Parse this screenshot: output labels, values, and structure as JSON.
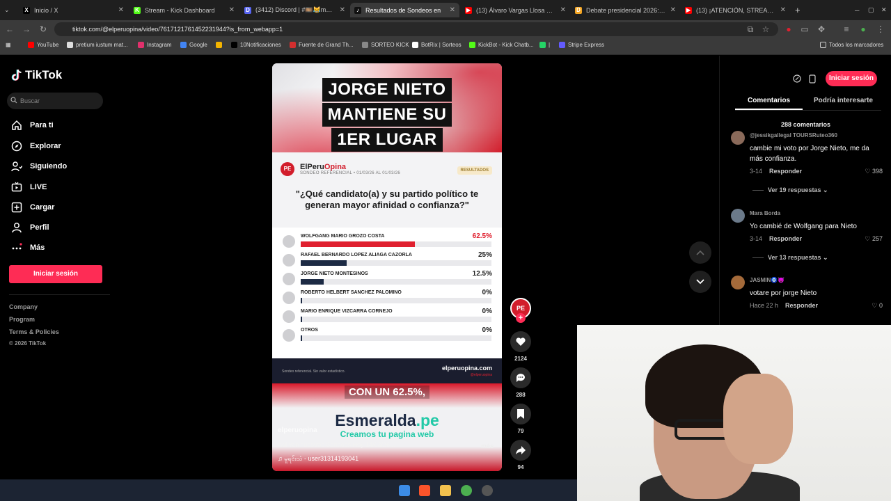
{
  "browser": {
    "tabs": [
      {
        "title": "Inicio / X",
        "color": "#000000",
        "glyph": "X"
      },
      {
        "title": "Stream - Kick Dashboard",
        "color": "#53fc18",
        "glyph": "K"
      },
      {
        "title": "(3412) Discord | #🎞️😹memes",
        "color": "#5865f2",
        "glyph": "D"
      },
      {
        "title": "Resultados de Sondeos en",
        "color": "#111111",
        "glyph": "♪"
      },
      {
        "title": "(13) Álvaro Vargas Llosa advierte",
        "color": "#ff0000",
        "glyph": "▶"
      },
      {
        "title": "Debate presidencial 2026: hoy",
        "color": "#f5a623",
        "glyph": "D"
      },
      {
        "title": "(13) ¡ATENCIÓN, STREAMERS!",
        "color": "#ff0000",
        "glyph": "▶"
      }
    ],
    "new_tab": "+",
    "url": "tiktok.com/@elperuopina/video/7617121761452231944?is_from_webapp=1",
    "bookmarks": [
      {
        "label": "YouTube",
        "color": "#ff0000"
      },
      {
        "label": "pretium iustum mat...",
        "color": "#dddddd"
      },
      {
        "label": "Instagram",
        "color": "#e1306c"
      },
      {
        "label": "Google",
        "color": "#4285f4"
      },
      {
        "label": "",
        "color": "#f4b400"
      },
      {
        "label": "10Notificaciones",
        "color": "#000000"
      },
      {
        "label": "Fuente de Grand Th...",
        "color": "#d32f2f"
      },
      {
        "label": "SORTEO KICK",
        "color": "#888888"
      },
      {
        "label": "BotRix | Sorteos",
        "color": "#ffffff"
      },
      {
        "label": "KickBot - Kick Chatb...",
        "color": "#53fc18"
      },
      {
        "label": "|",
        "color": "#25d366"
      },
      {
        "label": "Stripe Express",
        "color": "#635bff"
      }
    ],
    "all_bookmarks": "Todos los marcadores"
  },
  "sidebar": {
    "logo": "TikTok",
    "search_placeholder": "Buscar",
    "nav": [
      {
        "label": "Para ti",
        "icon": "home-icon"
      },
      {
        "label": "Explorar",
        "icon": "compass-icon"
      },
      {
        "label": "Siguiendo",
        "icon": "following-icon"
      },
      {
        "label": "LIVE",
        "icon": "live-icon"
      },
      {
        "label": "Cargar",
        "icon": "upload-icon"
      },
      {
        "label": "Perfil",
        "icon": "profile-icon"
      },
      {
        "label": "Más",
        "icon": "more-icon"
      }
    ],
    "login": "Iniciar sesión",
    "footer": [
      "Company",
      "Program",
      "Terms & Policies",
      "© 2026 TikTok"
    ]
  },
  "video": {
    "headline": [
      "JORGE NIETO",
      "MANTIENE SU",
      "1ER LUGAR"
    ],
    "brand_badge": "PE",
    "brand_name_a": "ElPeru",
    "brand_name_b": "Opina",
    "brand_sub": "SONDEO REFERENCIAL • 01/03/26 AL 01/03/26",
    "result_tag": "RESULTADOS",
    "question": "\"¿Qué candidato(a) y su partido político te generan mayor afinidad o confianza?\"",
    "results": [
      {
        "name": "WOLFGANG MARIO GROZO COSTA",
        "pct_label": "62.5%",
        "value": 62.5
      },
      {
        "name": "RAFAEL BERNARDO LOPEZ ALIAGA CAZORLA",
        "pct_label": "25%",
        "value": 25
      },
      {
        "name": "JORGE NIETO MONTESINOS",
        "pct_label": "12.5%",
        "value": 12.5
      },
      {
        "name": "ROBERTO HELBERT SANCHEZ PALOMINO",
        "pct_label": "0%",
        "value": 0
      },
      {
        "name": "MARIO ENRIQUE VIZCARRA CORNEJO",
        "pct_label": "0%",
        "value": 0
      },
      {
        "name": "OTROS",
        "pct_label": "0%",
        "value": 0
      }
    ],
    "footer_note": "Sondeo referencial. Sin valor estadístico.",
    "footer_site": "elperuopina.com",
    "footer_handle": "@elperuopina",
    "caption_overlay": "CON UN 62.5%,",
    "ad_a": "Esmeralda",
    "ad_b": ".pe",
    "ad_sub": "Creamos tu pagina web",
    "username": "elperuopina",
    "description": "Así van nuestros Sondeos Hoy 14/03/26...",
    "more": "más",
    "music": "♫  မူရင်းသံ  - user31314193041"
  },
  "actions": {
    "avatar": "PE",
    "follow": "+",
    "likes": "2124",
    "comments": "288",
    "saves": "79",
    "shares": "94"
  },
  "comments_panel": {
    "login": "Iniciar sesión",
    "tab_comments": "Comentarios",
    "tab_interesting": "Podría interesarte",
    "count": "288 comentarios",
    "reply_label": "Responder",
    "comments": [
      {
        "user": "@jessikgallegal TOURSRuteo360",
        "text": "cambie mi voto por Jorge Nieto, me da más confianza.",
        "date": "3-14",
        "likes": "398",
        "replies": "Ver 19 respuestas ⌄",
        "color": "#8a6a5a"
      },
      {
        "user": "Mara Borda",
        "text": "Yo cambié de Wolfgang para Nieto",
        "date": "3-14",
        "likes": "257",
        "replies": "Ver 13 respuestas ⌄",
        "color": "#6b7a8a"
      },
      {
        "user": "JASMIN🧿😈",
        "text": "votare por jorge Nieto",
        "date": "Hace 22 h",
        "likes": "0",
        "replies": "",
        "color": "#a46a3a"
      }
    ]
  },
  "colors": {
    "accent": "#fe2c55",
    "poll_red": "#e0202f",
    "poll_navy": "#1c2a44"
  }
}
